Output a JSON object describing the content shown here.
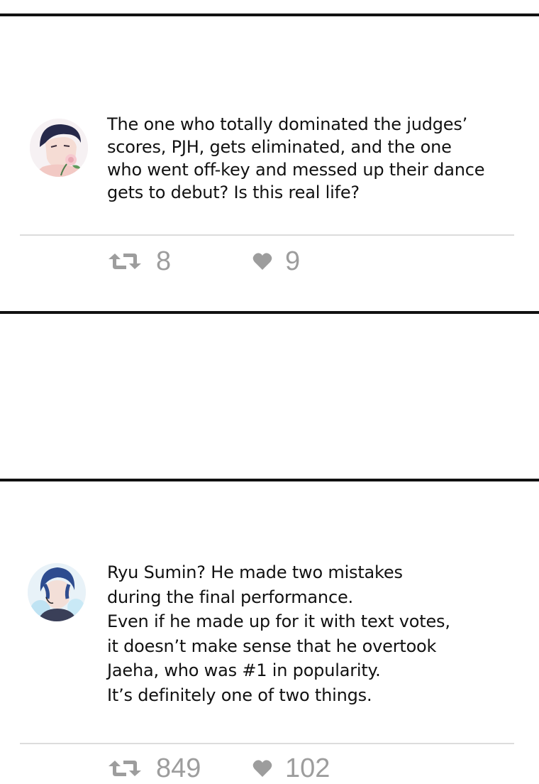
{
  "posts": [
    {
      "text_lines": [
        "The one who totally dominated the judges’",
        "scores, PJH, gets eliminated, and the one",
        "who went off-key and messed up their dance",
        "gets to debut? Is this real life?"
      ],
      "retweet_count": "8",
      "like_count": "9",
      "icons": {
        "retweet": "retweet-icon",
        "like": "heart-icon"
      }
    },
    {
      "text_lines": [
        "Ryu Sumin? He made two mistakes",
        "during the final performance.",
        "Even if he made up for it with text votes,",
        "it doesn’t make sense that he overtook",
        "Jaeha, who was #1 in popularity.",
        "It’s definitely one of two things."
      ],
      "retweet_count": "849",
      "like_count": "102",
      "icons": {
        "retweet": "retweet-icon",
        "like": "heart-icon"
      }
    }
  ],
  "colors": {
    "text": "#111111",
    "counts": "#9d9d9d",
    "panel_border": "#111111",
    "divider": "#dcdcdc"
  }
}
